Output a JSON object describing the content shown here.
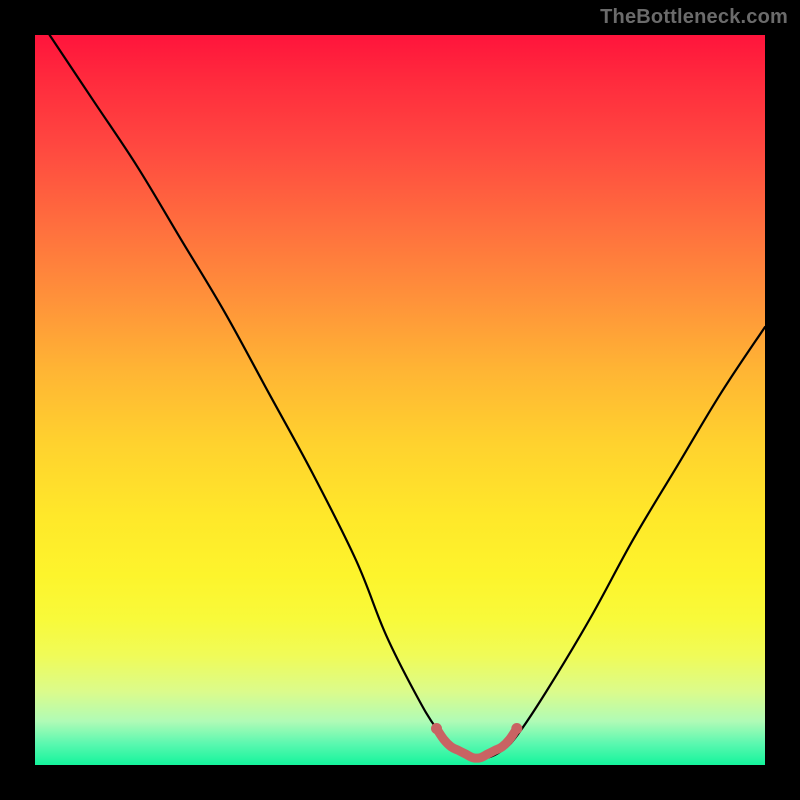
{
  "watermark": "TheBottleneck.com",
  "colors": {
    "page_bg": "#000000",
    "curve_main": "#000000",
    "curve_bottom": "#c96363",
    "gradient_top": "#ff143c",
    "gradient_bottom": "#14f49c"
  },
  "chart_data": {
    "type": "line",
    "title": "",
    "xlabel": "",
    "ylabel": "",
    "xlim": [
      0,
      100
    ],
    "ylim": [
      0,
      100
    ],
    "grid": false,
    "legend": false,
    "series": [
      {
        "name": "bottleneck-curve",
        "x": [
          2,
          8,
          14,
          20,
          26,
          32,
          38,
          44,
          48,
          52,
          55,
          58,
          60,
          62,
          64,
          66,
          70,
          76,
          82,
          88,
          94,
          100
        ],
        "y": [
          100,
          91,
          82,
          72,
          62,
          51,
          40,
          28,
          18,
          10,
          5,
          2,
          1,
          1,
          2,
          4,
          10,
          20,
          31,
          41,
          51,
          60
        ]
      },
      {
        "name": "bottom-highlight",
        "x": [
          55,
          56,
          57,
          58,
          59,
          60,
          61,
          62,
          63,
          64,
          65,
          66
        ],
        "y": [
          5,
          3.5,
          2.5,
          2,
          1.5,
          1,
          1,
          1.5,
          2,
          2.5,
          3.5,
          5
        ]
      }
    ]
  }
}
